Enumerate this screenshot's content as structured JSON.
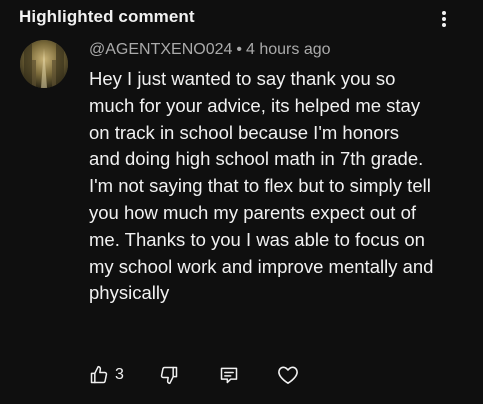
{
  "header": {
    "title": "Highlighted comment"
  },
  "comment": {
    "author": "@AGENTXENO024",
    "separator": "•",
    "time": "4 hours ago",
    "text": "Hey I just wanted to say thank you so much for your advice, its helped me stay on track in school because I'm honors and doing high school math in 7th grade. I'm not saying that to flex but to simply tell you how much my parents expect out of me. Thanks to you I was able to focus on my school work and improve mentally and physically"
  },
  "actions": {
    "like_count": "3",
    "icons": [
      "thumbs-up-icon",
      "thumbs-down-icon",
      "reply-icon",
      "heart-icon"
    ]
  },
  "colors": {
    "background": "#0f0f0f",
    "text": "#f1f1f1",
    "meta": "#aaaaaa"
  }
}
